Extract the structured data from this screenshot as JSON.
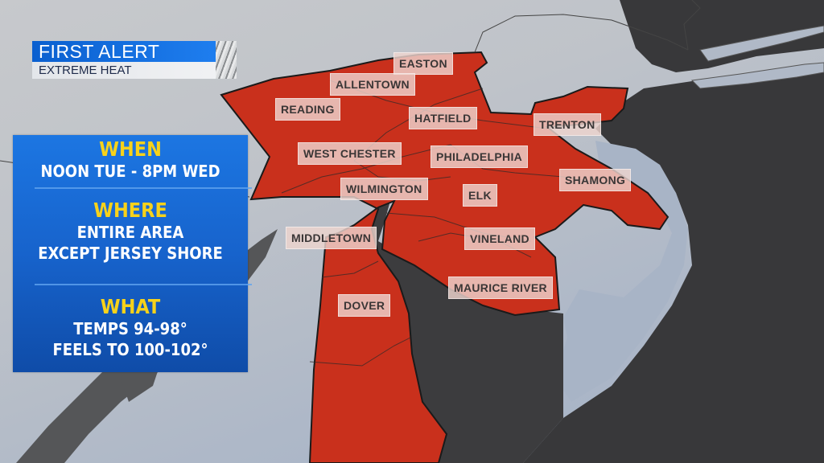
{
  "header": {
    "title": "FIRST ALERT",
    "subtitle": "EXTREME HEAT"
  },
  "panel": {
    "sections": [
      {
        "heading": "WHEN",
        "lines": [
          "NOON TUE - 8PM WED"
        ]
      },
      {
        "heading": "WHERE",
        "lines": [
          "ENTIRE AREA",
          "EXCEPT JERSEY SHORE"
        ]
      },
      {
        "heading": "WHAT",
        "lines": [
          "TEMPS 94-98°",
          "FEELS TO 100-102°"
        ]
      }
    ]
  },
  "map": {
    "alert_color": "#c9301c",
    "land_color": "#b7bdc6",
    "water_color": "#3a3a3c",
    "panel_color": "#1867d4",
    "heading_color": "#f7d21a",
    "cities": [
      "EASTON",
      "ALLENTOWN",
      "READING",
      "HATFIELD",
      "TRENTON",
      "WEST CHESTER",
      "PHILADELPHIA",
      "SHAMONG",
      "WILMINGTON",
      "ELK",
      "MIDDLETOWN",
      "VINELAND",
      "MAURICE RIVER",
      "DOVER"
    ]
  }
}
